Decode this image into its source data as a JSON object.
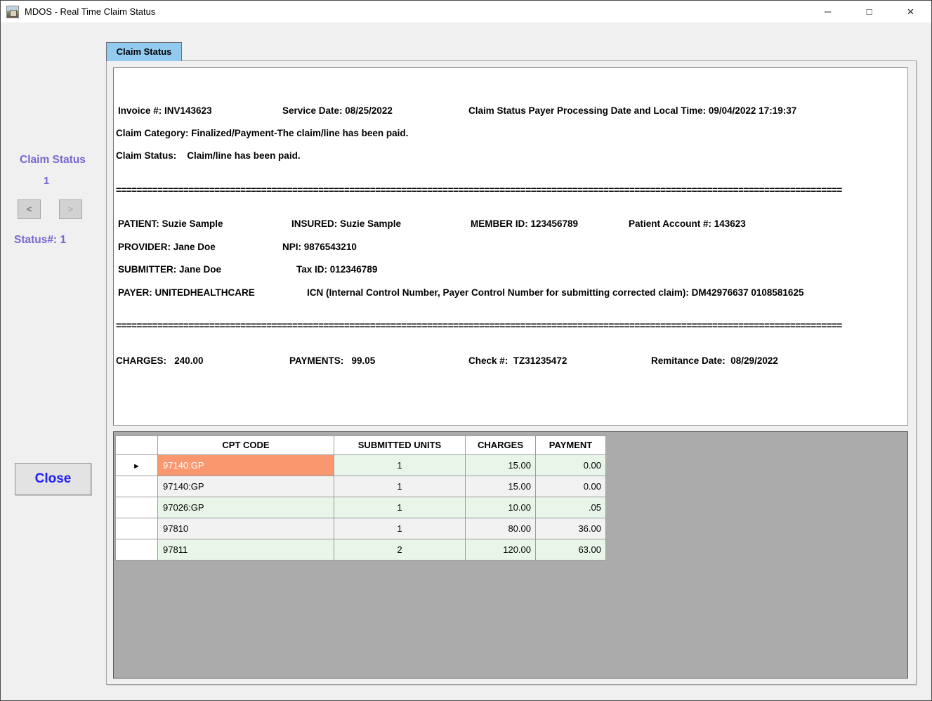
{
  "window": {
    "title": "MDOS - Real Time Claim Status",
    "glyphs": {
      "minimize": "─",
      "maximize": "□",
      "close": "×"
    }
  },
  "tab": {
    "label": "Claim Status"
  },
  "nav": {
    "title": "Claim Status",
    "current_claim": "1",
    "prev_label": "<",
    "next_label": ">",
    "status_label": "Status#: 1"
  },
  "close_button_label": "Close",
  "claim_info": {
    "invoice": "Invoice #: INV143623",
    "service_date": "Service Date: 08/25/2022",
    "processing_datetime": "Claim Status Payer Processing Date and Local Time: 09/04/2022 17:19:37",
    "claim_category": "Claim Category: Finalized/Payment-The claim/line has been paid.",
    "claim_status": "Claim Status:    Claim/line has been paid.",
    "separator": "============================================================================================================================================",
    "patient": "PATIENT: Suzie Sample",
    "insured": "INSURED: Suzie Sample",
    "member_id": "MEMBER ID: 123456789",
    "patient_account": "Patient Account #: 143623",
    "provider": "PROVIDER: Jane Doe",
    "npi": "NPI: 9876543210",
    "submitter": "SUBMITTER: Jane Doe",
    "tax_id": "Tax ID: 012346789",
    "payer": "PAYER: UNITEDHEALTHCARE",
    "icn": "ICN (Internal Control Number, Payer Control Number for submitting corrected claim): DM42976637 0108581625",
    "charges": "CHARGES:   240.00",
    "payments": "PAYMENTS:   99.05",
    "check_number": "Check #:  TZ31235472",
    "remittance_date": "Remitance Date:  08/29/2022"
  },
  "grid": {
    "columns": [
      "",
      "CPT CODE",
      "SUBMITTED UNITS",
      "CHARGES",
      "PAYMENT"
    ],
    "row_selector_glyph": "►",
    "rows": [
      {
        "cpt": "97140:GP",
        "units": "1",
        "charges": "15.00",
        "payment": "0.00"
      },
      {
        "cpt": "97140:GP",
        "units": "1",
        "charges": "15.00",
        "payment": "0.00"
      },
      {
        "cpt": "97026:GP",
        "units": "1",
        "charges": "10.00",
        "payment": ".05"
      },
      {
        "cpt": "97810",
        "units": "1",
        "charges": "80.00",
        "payment": "36.00"
      },
      {
        "cpt": "97811",
        "units": "2",
        "charges": "120.00",
        "payment": "63.00"
      }
    ]
  },
  "colors": {
    "accent_purple": "#7a64d2",
    "close_text_blue": "#2020f0",
    "tab_blue": "#92cbee",
    "selected_cell_orange": "#f9976e",
    "row_green": "#e9f5e9",
    "row_grey": "#f2f2f2",
    "grid_panel_grey": "#ababab",
    "window_bg": "#f0f0f0"
  }
}
